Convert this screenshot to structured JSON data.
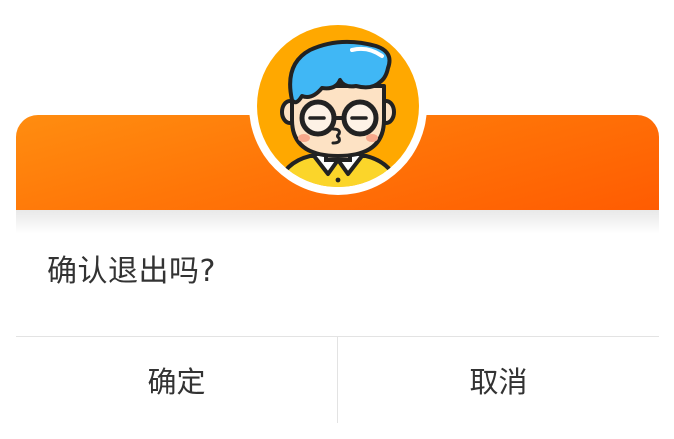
{
  "dialog": {
    "message": "确认退出吗?",
    "confirm_label": "确定",
    "cancel_label": "取消"
  },
  "avatar": {
    "icon": "cartoon-boy-avatar-icon"
  },
  "colors": {
    "header_gradient_start": "#ff8d10",
    "header_gradient_end": "#ff5c02",
    "avatar_background": "#ffa800",
    "hair": "#40b7f5",
    "shirt": "#fbd52a",
    "text": "#333333",
    "divider": "#e3e3e3"
  }
}
